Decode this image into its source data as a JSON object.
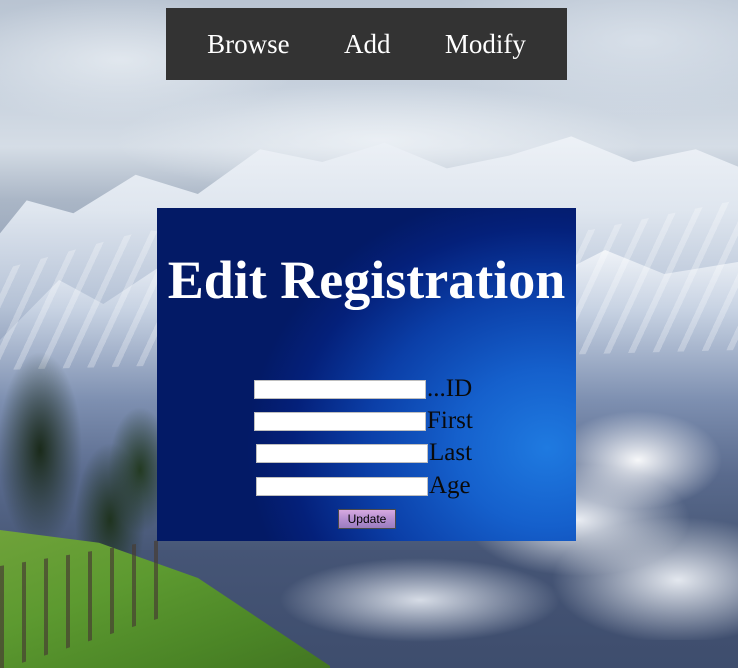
{
  "nav": {
    "browse_label": "Browse",
    "add_label": "Add",
    "modify_label": "Modify"
  },
  "panel": {
    "title": "Edit Registration"
  },
  "form": {
    "id": {
      "label": "...ID",
      "value": "",
      "placeholder": ""
    },
    "first": {
      "label": "First",
      "value": "",
      "placeholder": ""
    },
    "last": {
      "label": "Last",
      "value": "",
      "placeholder": ""
    },
    "age": {
      "label": "Age",
      "value": "",
      "placeholder": ""
    },
    "update_label": "Update"
  },
  "colors": {
    "navbar_bg": "#333333",
    "panel_bg": "#0b3fa8",
    "button_bg": "#b58fd0"
  }
}
